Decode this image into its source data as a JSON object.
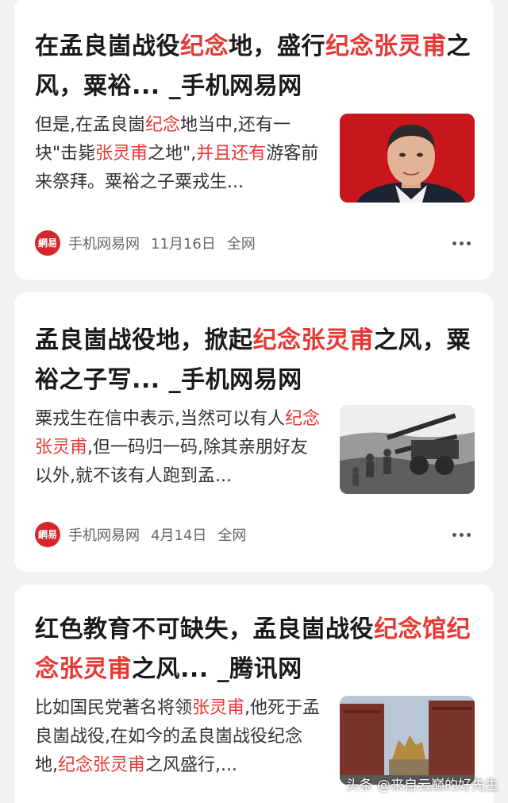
{
  "articles": [
    {
      "title": [
        {
          "t": "在孟良崮战役",
          "h": false
        },
        {
          "t": "纪念",
          "h": true
        },
        {
          "t": "地，盛行",
          "h": false
        },
        {
          "t": "纪念张灵甫",
          "h": true
        },
        {
          "t": "之风，粟裕... _手机网易网",
          "h": false
        }
      ],
      "snippet": [
        {
          "t": "但是,在孟良崮",
          "h": false
        },
        {
          "t": "纪念",
          "h": true
        },
        {
          "t": "地当中,还有一块\"击毙",
          "h": false
        },
        {
          "t": "张灵甫",
          "h": true
        },
        {
          "t": "之地\",",
          "h": false
        },
        {
          "t": "并且还有",
          "h": true
        },
        {
          "t": "游客前来祭拜。粟裕之子粟戎生...",
          "h": false
        }
      ],
      "thumb": "portrait",
      "source_logo": "網易",
      "source": "手机网易网",
      "date": "11月16日",
      "scope": "全网"
    },
    {
      "title": [
        {
          "t": "孟良崮战役地，掀起",
          "h": false
        },
        {
          "t": "纪念张灵甫",
          "h": true
        },
        {
          "t": "之风，粟裕之子写... _手机网易网",
          "h": false
        }
      ],
      "snippet": [
        {
          "t": "粟戎生在信中表示,当然可以有人",
          "h": false
        },
        {
          "t": "纪念张灵甫",
          "h": true
        },
        {
          "t": ",但一码归一码,除其亲朋好友以外,就不该有人跑到孟...",
          "h": false
        }
      ],
      "thumb": "artillery",
      "source_logo": "網易",
      "source": "手机网易网",
      "date": "4月14日",
      "scope": "全网"
    },
    {
      "title": [
        {
          "t": "红色教育不可缺失，孟良崮战役",
          "h": false
        },
        {
          "t": "纪念馆纪念张灵甫",
          "h": true
        },
        {
          "t": "之风... _腾讯网",
          "h": false
        }
      ],
      "snippet": [
        {
          "t": "比如国民党著名将领",
          "h": false
        },
        {
          "t": "张灵甫",
          "h": true
        },
        {
          "t": ",他死于孟良崮战役,在如今的孟良崮战役纪念地,",
          "h": false
        },
        {
          "t": "纪念张灵甫",
          "h": true
        },
        {
          "t": "之风盛行,...",
          "h": false
        }
      ],
      "thumb": "memorial"
    }
  ],
  "watermark": "头条 @来自云巅的好先生",
  "colors": {
    "highlight": "#e53935",
    "source_logo": "#d6262b",
    "background": "#f2f2f4"
  }
}
